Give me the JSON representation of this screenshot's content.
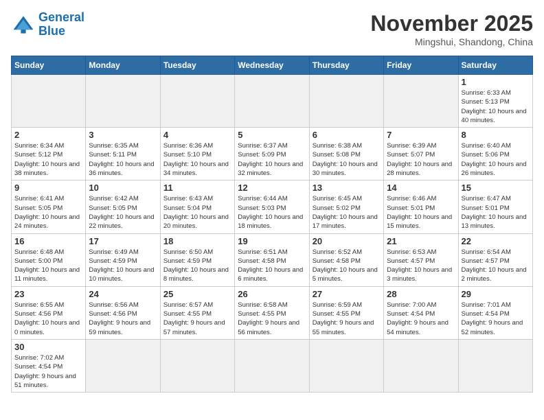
{
  "logo": {
    "general": "General",
    "blue": "Blue"
  },
  "header": {
    "month": "November 2025",
    "location": "Mingshui, Shandong, China"
  },
  "weekdays": [
    "Sunday",
    "Monday",
    "Tuesday",
    "Wednesday",
    "Thursday",
    "Friday",
    "Saturday"
  ],
  "days": [
    {
      "date": "",
      "info": ""
    },
    {
      "date": "",
      "info": ""
    },
    {
      "date": "",
      "info": ""
    },
    {
      "date": "",
      "info": ""
    },
    {
      "date": "",
      "info": ""
    },
    {
      "date": "",
      "info": ""
    },
    {
      "date": "1",
      "info": "Sunrise: 6:33 AM\nSunset: 5:13 PM\nDaylight: 10 hours and 40 minutes."
    },
    {
      "date": "2",
      "info": "Sunrise: 6:34 AM\nSunset: 5:12 PM\nDaylight: 10 hours and 38 minutes."
    },
    {
      "date": "3",
      "info": "Sunrise: 6:35 AM\nSunset: 5:11 PM\nDaylight: 10 hours and 36 minutes."
    },
    {
      "date": "4",
      "info": "Sunrise: 6:36 AM\nSunset: 5:10 PM\nDaylight: 10 hours and 34 minutes."
    },
    {
      "date": "5",
      "info": "Sunrise: 6:37 AM\nSunset: 5:09 PM\nDaylight: 10 hours and 32 minutes."
    },
    {
      "date": "6",
      "info": "Sunrise: 6:38 AM\nSunset: 5:08 PM\nDaylight: 10 hours and 30 minutes."
    },
    {
      "date": "7",
      "info": "Sunrise: 6:39 AM\nSunset: 5:07 PM\nDaylight: 10 hours and 28 minutes."
    },
    {
      "date": "8",
      "info": "Sunrise: 6:40 AM\nSunset: 5:06 PM\nDaylight: 10 hours and 26 minutes."
    },
    {
      "date": "9",
      "info": "Sunrise: 6:41 AM\nSunset: 5:05 PM\nDaylight: 10 hours and 24 minutes."
    },
    {
      "date": "10",
      "info": "Sunrise: 6:42 AM\nSunset: 5:05 PM\nDaylight: 10 hours and 22 minutes."
    },
    {
      "date": "11",
      "info": "Sunrise: 6:43 AM\nSunset: 5:04 PM\nDaylight: 10 hours and 20 minutes."
    },
    {
      "date": "12",
      "info": "Sunrise: 6:44 AM\nSunset: 5:03 PM\nDaylight: 10 hours and 18 minutes."
    },
    {
      "date": "13",
      "info": "Sunrise: 6:45 AM\nSunset: 5:02 PM\nDaylight: 10 hours and 17 minutes."
    },
    {
      "date": "14",
      "info": "Sunrise: 6:46 AM\nSunset: 5:01 PM\nDaylight: 10 hours and 15 minutes."
    },
    {
      "date": "15",
      "info": "Sunrise: 6:47 AM\nSunset: 5:01 PM\nDaylight: 10 hours and 13 minutes."
    },
    {
      "date": "16",
      "info": "Sunrise: 6:48 AM\nSunset: 5:00 PM\nDaylight: 10 hours and 11 minutes."
    },
    {
      "date": "17",
      "info": "Sunrise: 6:49 AM\nSunset: 4:59 PM\nDaylight: 10 hours and 10 minutes."
    },
    {
      "date": "18",
      "info": "Sunrise: 6:50 AM\nSunset: 4:59 PM\nDaylight: 10 hours and 8 minutes."
    },
    {
      "date": "19",
      "info": "Sunrise: 6:51 AM\nSunset: 4:58 PM\nDaylight: 10 hours and 6 minutes."
    },
    {
      "date": "20",
      "info": "Sunrise: 6:52 AM\nSunset: 4:58 PM\nDaylight: 10 hours and 5 minutes."
    },
    {
      "date": "21",
      "info": "Sunrise: 6:53 AM\nSunset: 4:57 PM\nDaylight: 10 hours and 3 minutes."
    },
    {
      "date": "22",
      "info": "Sunrise: 6:54 AM\nSunset: 4:57 PM\nDaylight: 10 hours and 2 minutes."
    },
    {
      "date": "23",
      "info": "Sunrise: 6:55 AM\nSunset: 4:56 PM\nDaylight: 10 hours and 0 minutes."
    },
    {
      "date": "24",
      "info": "Sunrise: 6:56 AM\nSunset: 4:56 PM\nDaylight: 9 hours and 59 minutes."
    },
    {
      "date": "25",
      "info": "Sunrise: 6:57 AM\nSunset: 4:55 PM\nDaylight: 9 hours and 57 minutes."
    },
    {
      "date": "26",
      "info": "Sunrise: 6:58 AM\nSunset: 4:55 PM\nDaylight: 9 hours and 56 minutes."
    },
    {
      "date": "27",
      "info": "Sunrise: 6:59 AM\nSunset: 4:55 PM\nDaylight: 9 hours and 55 minutes."
    },
    {
      "date": "28",
      "info": "Sunrise: 7:00 AM\nSunset: 4:54 PM\nDaylight: 9 hours and 54 minutes."
    },
    {
      "date": "29",
      "info": "Sunrise: 7:01 AM\nSunset: 4:54 PM\nDaylight: 9 hours and 52 minutes."
    },
    {
      "date": "30",
      "info": "Sunrise: 7:02 AM\nSunset: 4:54 PM\nDaylight: 9 hours and 51 minutes."
    }
  ]
}
